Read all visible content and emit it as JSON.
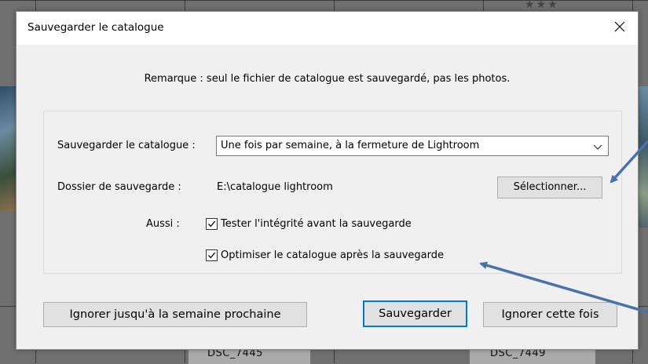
{
  "dialog": {
    "title": "Sauvegarder le catalogue",
    "note": "Remarque : seul le fichier de catalogue est sauvegardé, pas les photos.",
    "backup": {
      "label": "Sauvegarder le catalogue :",
      "selected": "Une fois par semaine, à la fermeture de Lightroom"
    },
    "folder": {
      "label": "Dossier de sauvegarde :",
      "value": "E:\\catalogue lightroom",
      "button": "Sélectionner..."
    },
    "also": {
      "label": "Aussi :",
      "options": [
        {
          "label": "Tester l'intégrité avant la sauvegarde",
          "checked": true
        },
        {
          "label": "Optimiser le catalogue après la sauvegarde",
          "checked": true
        }
      ]
    },
    "buttons": {
      "ignore_week": "Ignorer jusqu'à la semaine prochaine",
      "save": "Sauvegarder",
      "ignore_once": "Ignorer cette fois"
    }
  },
  "background": {
    "thumb_labels": [
      "DSC_7445",
      "DSC_7449"
    ],
    "stars": "★★★"
  },
  "colors": {
    "accent": "#0078d7",
    "annotation_arrow": "#4a72a8"
  },
  "icons": {
    "close": "close-icon",
    "dropdown": "chevron-down-icon",
    "check": "checkmark-icon"
  }
}
